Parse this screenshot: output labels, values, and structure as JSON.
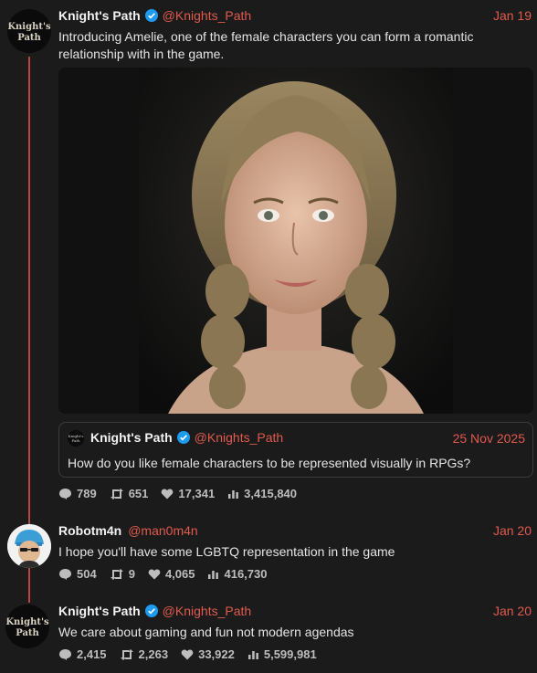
{
  "post1": {
    "author": "Knight's Path",
    "handle": "@Knights_Path",
    "date": "Jan 19",
    "text": "Introducing Amelie, one of the female characters you can form a romantic relationship with in the game.",
    "avatar_logo_text": "Knight's Path",
    "quote": {
      "author": "Knight's Path",
      "handle": "@Knights_Path",
      "date": "25 Nov 2025",
      "text": "How do you like female characters to be represented visually in RPGs?"
    },
    "stats": {
      "replies": "789",
      "reposts": "651",
      "likes": "17,341",
      "views": "3,415,840"
    }
  },
  "post2": {
    "author": "Robotm4n",
    "handle": "@man0m4n",
    "date": "Jan 20",
    "text": "I hope you'll have some LGBTQ representation in the game",
    "stats": {
      "replies": "504",
      "reposts": "9",
      "likes": "4,065",
      "views": "416,730"
    }
  },
  "post3": {
    "author": "Knight's Path",
    "handle": "@Knights_Path",
    "date": "Jan 20",
    "text": "We care about gaming and fun not modern agendas",
    "avatar_logo_text": "Knight's Path",
    "stats": {
      "replies": "2,415",
      "reposts": "2,263",
      "likes": "33,922",
      "views": "5,599,981"
    }
  },
  "colors": {
    "accent": "#e05a4e",
    "thread": "#b7483f",
    "verified": "#1d9bf0",
    "background": "#1b1b1b"
  },
  "icons": [
    "reply-icon",
    "repost-icon",
    "like-icon",
    "views-icon",
    "verified-icon"
  ]
}
